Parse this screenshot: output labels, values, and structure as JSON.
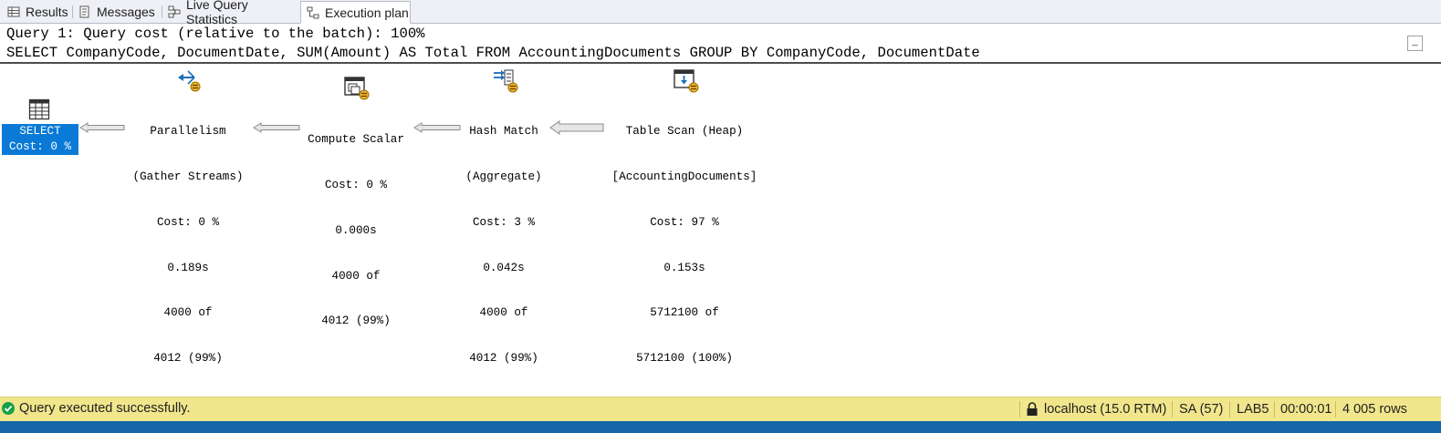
{
  "tabs": [
    {
      "label": "Results",
      "icon": "grid-icon"
    },
    {
      "label": "Messages",
      "icon": "message-icon"
    },
    {
      "label": "Live Query Statistics",
      "icon": "live-stats-icon"
    },
    {
      "label": "Execution plan",
      "icon": "execution-plan-icon",
      "active": true
    }
  ],
  "query": {
    "header": "Query 1: Query cost (relative to the batch): 100%",
    "sql": "SELECT CompanyCode, DocumentDate, SUM(Amount) AS Total FROM AccountingDocuments GROUP BY CompanyCode, DocumentDate",
    "collapse_label": "_"
  },
  "plan": {
    "select": {
      "label": "SELECT",
      "cost": "Cost: 0 %"
    },
    "operators": [
      {
        "title": "Parallelism",
        "subtitle": "(Gather Streams)",
        "cost": "Cost: 0 %",
        "time": "0.189s",
        "rows": "4000 of",
        "estimate": "4012 (99%)",
        "icon": "parallelism-icon"
      },
      {
        "title": "Compute Scalar",
        "subtitle": "",
        "cost": "Cost: 0 %",
        "time": "0.000s",
        "rows": "4000 of",
        "estimate": "4012 (99%)",
        "icon": "compute-scalar-icon"
      },
      {
        "title": "Hash Match",
        "subtitle": "(Aggregate)",
        "cost": "Cost: 3 %",
        "time": "0.042s",
        "rows": "4000 of",
        "estimate": "4012 (99%)",
        "icon": "hash-match-icon"
      },
      {
        "title": "Table Scan (Heap)",
        "subtitle": "[AccountingDocuments]",
        "cost": "Cost: 97 %",
        "time": "0.153s",
        "rows": "5712100 of",
        "estimate": "5712100 (100%)",
        "icon": "table-scan-icon"
      }
    ]
  },
  "status": {
    "message": "Query executed successfully.",
    "server": "localhost (15.0 RTM)",
    "user": "SA (57)",
    "database": "LAB5",
    "elapsed": "00:00:01",
    "rows": "4 005 rows"
  },
  "colors": {
    "select_highlight": "#0a7ad6",
    "status_bar": "#f1e68c",
    "success": "#17a04a",
    "bottom_strip": "#1466a8"
  }
}
